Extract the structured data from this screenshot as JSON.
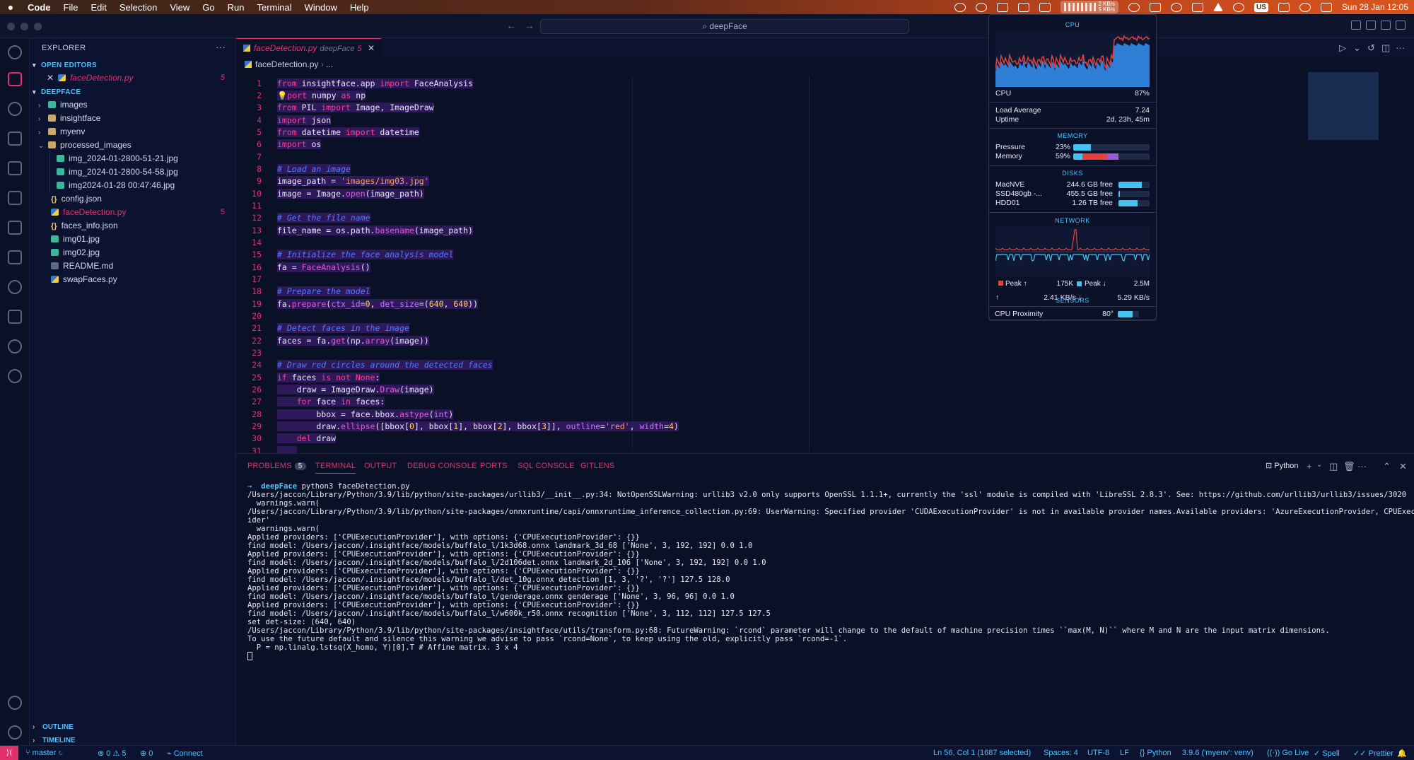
{
  "menubar": {
    "app": "Code",
    "items": [
      "File",
      "Edit",
      "Selection",
      "View",
      "Go",
      "Run",
      "Terminal",
      "Window",
      "Help"
    ],
    "net_up": "2 KB/s",
    "net_down": "5 KB/s",
    "input": "US",
    "clock": "Sun 28 Jan  12:05"
  },
  "titlebar": {
    "search": "deepFace"
  },
  "sidebar": {
    "title": "EXPLORER",
    "open_editors_label": "OPEN EDITORS",
    "open_editors": [
      {
        "name": "faceDetection.py",
        "badge": "5"
      }
    ],
    "folder_label": "DEEPFACE",
    "tree": [
      {
        "name": "images",
        "kind": "folder"
      },
      {
        "name": "insightface",
        "kind": "folder"
      },
      {
        "name": "myenv",
        "kind": "folder"
      },
      {
        "name": "processed_images",
        "kind": "folder-open"
      },
      {
        "name": "img_2024-01-2800-51-21.jpg",
        "kind": "img",
        "nested": true
      },
      {
        "name": "img_2024-01-2800-54-58.jpg",
        "kind": "img",
        "nested": true
      },
      {
        "name": "img2024-01-28 00:47:46.jpg",
        "kind": "img",
        "nested": true
      },
      {
        "name": "config.json",
        "kind": "json"
      },
      {
        "name": "faceDetection.py",
        "kind": "py",
        "badge": "5"
      },
      {
        "name": "faces_info.json",
        "kind": "json"
      },
      {
        "name": "img01.jpg",
        "kind": "img"
      },
      {
        "name": "img02.jpg",
        "kind": "img"
      },
      {
        "name": "README.md",
        "kind": "md"
      },
      {
        "name": "swapFaces.py",
        "kind": "py"
      }
    ],
    "outline_label": "OUTLINE",
    "timeline_label": "TIMELINE"
  },
  "editor": {
    "tab": {
      "name": "faceDetection.py",
      "folder": "deepFace",
      "badge": "5"
    },
    "breadcrumb": {
      "file": "faceDetection.py",
      "rest": "..."
    }
  },
  "stats": {
    "cpu_header": "CPU",
    "cpu_label": "CPU",
    "cpu_value": "87%",
    "load_label": "Load Average",
    "load_value": "7.24",
    "uptime_label": "Uptime",
    "uptime_value": "2d, 23h, 45m",
    "memory_header": "MEMORY",
    "pressure_label": "Pressure",
    "pressure_value": "23%",
    "pressure_fraction": 0.23,
    "memory_label": "Memory",
    "memory_value": "59%",
    "memory_fraction": 0.59,
    "disks_header": "DISKS",
    "disks": [
      {
        "name": "MacNVE",
        "free": "244.6 GB free",
        "fraction": 0.75
      },
      {
        "name": "SSD480gb -...",
        "free": "455.5 GB free",
        "fraction": 0.05
      },
      {
        "name": "HDD01",
        "free": "1.26 TB free",
        "fraction": 0.62
      }
    ],
    "network_header": "NETWORK",
    "peak_up_label": "Peak ↑",
    "peak_up_value": "175K",
    "peak_down_label": "Peak ↓",
    "peak_down_value": "2.5M",
    "rate_up_arrow": "↑",
    "rate_up": "2.41 KB/s ↓",
    "rate_down": "5.29 KB/s",
    "sensors_header": "SENSORS",
    "sensor_label": "CPU Proximity",
    "sensor_value": "80°",
    "sensor_fraction": 0.7,
    "colors": {
      "accent": "#45c3ee",
      "cpu_red": "#e8413c",
      "cpu_blue": "#2f7fd6",
      "memory_purple": "#9b59d6"
    }
  },
  "panel": {
    "tabs": [
      "PROBLEMS",
      "TERMINAL",
      "OUTPUT",
      "DEBUG CONSOLE",
      "PORTS",
      "SQL CONSOLE",
      "GITLENS"
    ],
    "problems_count": "5",
    "shell": "Python",
    "prompt_dir": "deepFace",
    "prompt_cmd": "python3 faceDetection.py",
    "lines": [
      "/Users/jaccon/Library/Python/3.9/lib/python/site-packages/urllib3/__init__.py:34: NotOpenSSLWarning: urllib3 v2.0 only supports OpenSSL 1.1.1+, currently the 'ssl' module is compiled with 'LibreSSL 2.8.3'. See: https://github.com/urllib3/urllib3/issues/3020",
      "  warnings.warn(",
      "/Users/jaccon/Library/Python/3.9/lib/python/site-packages/onnxruntime/capi/onnxruntime_inference_collection.py:69: UserWarning: Specified provider 'CUDAExecutionProvider' is not in available provider names.Available providers: 'AzureExecutionProvider, CPUExecutionProv",
      "ider'",
      "  warnings.warn(",
      "Applied providers: ['CPUExecutionProvider'], with options: {'CPUExecutionProvider': {}}",
      "find model: /Users/jaccon/.insightface/models/buffalo_l/1k3d68.onnx landmark_3d_68 ['None', 3, 192, 192] 0.0 1.0",
      "Applied providers: ['CPUExecutionProvider'], with options: {'CPUExecutionProvider': {}}",
      "find model: /Users/jaccon/.insightface/models/buffalo_l/2d106det.onnx landmark_2d_106 ['None', 3, 192, 192] 0.0 1.0",
      "Applied providers: ['CPUExecutionProvider'], with options: {'CPUExecutionProvider': {}}",
      "find model: /Users/jaccon/.insightface/models/buffalo_l/det_10g.onnx detection [1, 3, '?', '?'] 127.5 128.0",
      "Applied providers: ['CPUExecutionProvider'], with options: {'CPUExecutionProvider': {}}",
      "find model: /Users/jaccon/.insightface/models/buffalo_l/genderage.onnx genderage ['None', 3, 96, 96] 0.0 1.0",
      "Applied providers: ['CPUExecutionProvider'], with options: {'CPUExecutionProvider': {}}",
      "find model: /Users/jaccon/.insightface/models/buffalo_l/w600k_r50.onnx recognition ['None', 3, 112, 112] 127.5 127.5",
      "set det-size: (640, 640)",
      "/Users/jaccon/Library/Python/3.9/lib/python/site-packages/insightface/utils/transform.py:68: FutureWarning: `rcond` parameter will change to the default of machine precision times ``max(M, N)`` where M and N are the input matrix dimensions.",
      "To use the future default and silence this warning we advise to pass `rcond=None`, to keep using the old, explicitly pass `rcond=-1`.",
      "  P = np.linalg.lstsq(X_homo, Y)[0].T # Affine matrix. 3 x 4"
    ]
  },
  "statusbar": {
    "branch": "master",
    "errors": "0",
    "warnings": "5",
    "ports": "0",
    "connect": "Connect",
    "position": "Ln 56, Col 1 (1687 selected)",
    "spaces": "Spaces: 4",
    "encoding": "UTF-8",
    "eol": "LF",
    "language": "Python",
    "interpreter": "3.9.6 ('myenv': venv)",
    "golive": "Go Live",
    "spell": "Spell",
    "prettier": "Prettier"
  }
}
